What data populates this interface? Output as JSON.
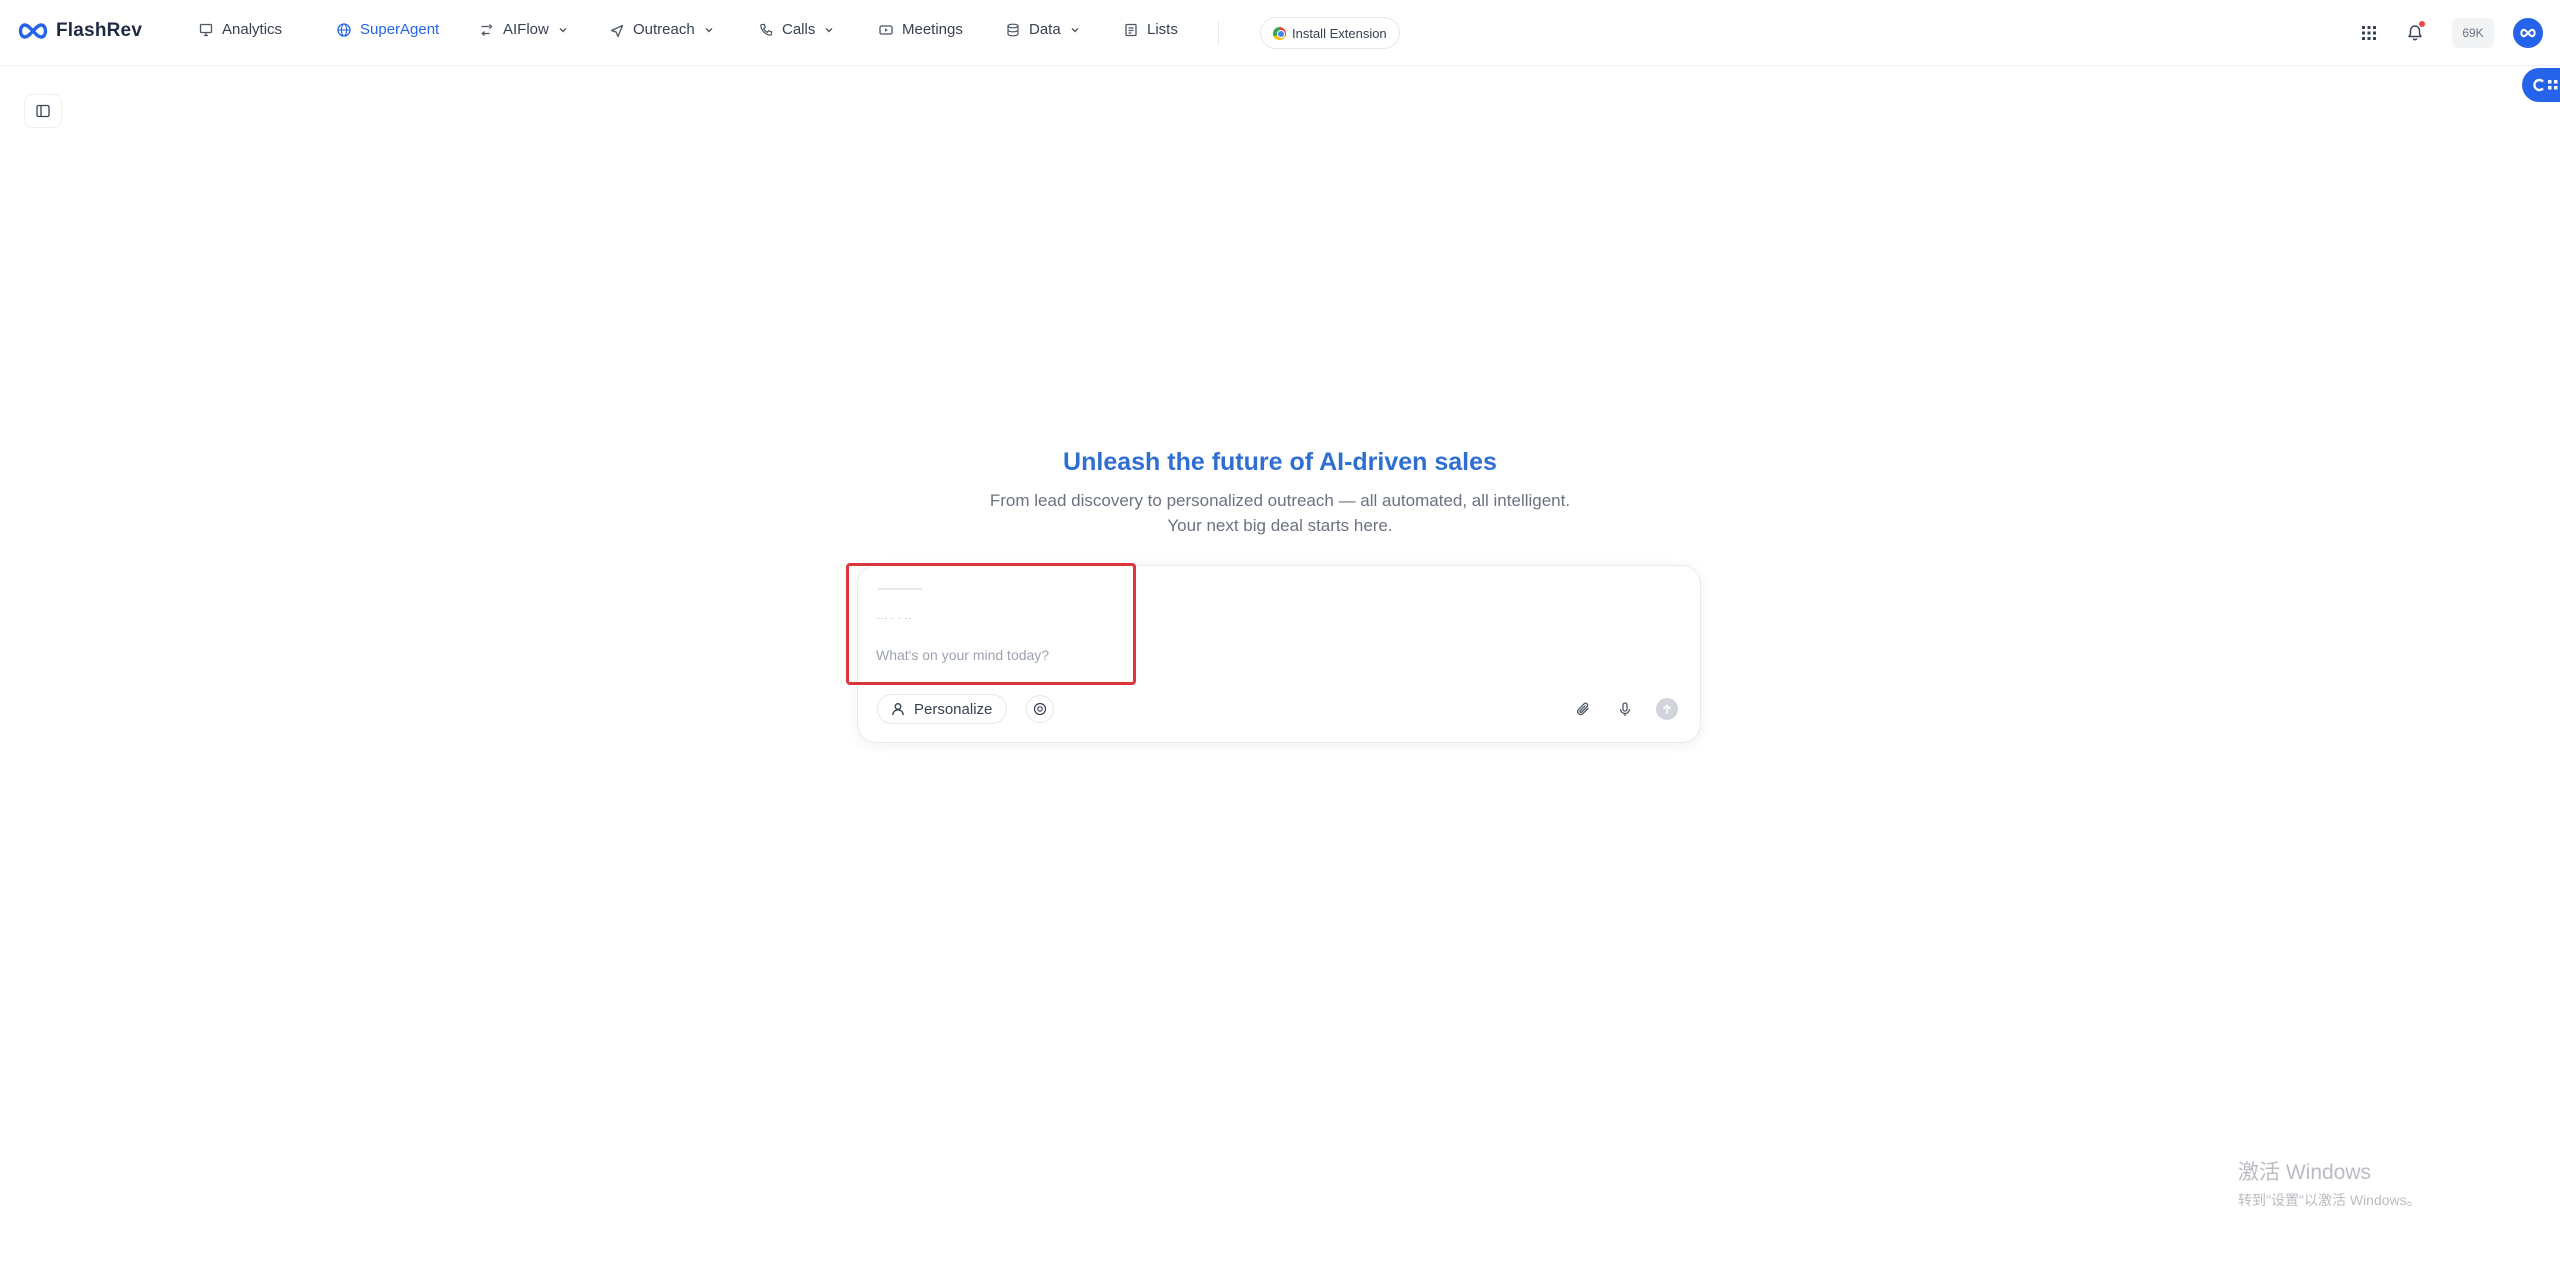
{
  "brand": {
    "name": "FlashRev",
    "accent": "#2563eb"
  },
  "nav": {
    "analytics": "Analytics",
    "superagent": "SuperAgent",
    "aiflow": "AIFlow",
    "outreach": "Outreach",
    "calls": "Calls",
    "meetings": "Meetings",
    "data": "Data",
    "lists": "Lists"
  },
  "install_extension": "Install Extension",
  "credits": "69K",
  "hero": {
    "title": "Unleash the future of AI-driven sales",
    "subtitle_line1": "From lead discovery to personalized outreach — all automated, all intelligent.",
    "subtitle_line2": "Your next big deal starts here."
  },
  "composer": {
    "ghost_text": "... . . ..",
    "placeholder": "What's on your mind today?",
    "personalize_label": "Personalize"
  },
  "watermark": {
    "line1": "激活 Windows",
    "line2": "转到\"设置\"以激活 Windows。"
  },
  "icons": {
    "logo": "infinity-icon",
    "analytics": "monitor-icon",
    "superagent": "globe-icon",
    "aiflow": "flow-icon",
    "outreach": "send-icon",
    "calls": "phone-icon",
    "meetings": "video-icon",
    "data": "database-icon",
    "lists": "list-icon",
    "apps": "grid-icon",
    "notifications": "bell-icon",
    "sidebar": "sidebar-icon",
    "personalize": "user-icon",
    "target": "target-icon",
    "attach": "paperclip-icon",
    "mic": "microphone-icon",
    "send": "arrow-up-icon"
  }
}
